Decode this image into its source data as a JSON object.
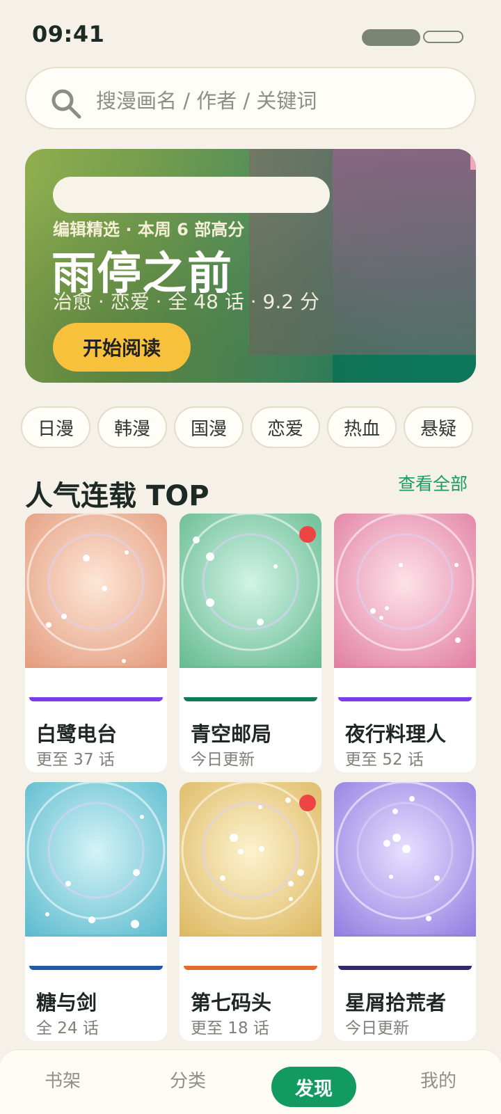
{
  "status": {
    "time": "09:41"
  },
  "search": {
    "placeholder": "搜漫画名 / 作者 / 关键词"
  },
  "hero": {
    "kicker": "编辑精选 · 本周 6 部高分",
    "title": "雨停之前",
    "meta": "治愈 · 恋爱 · 全 48 话 · 9.2 分",
    "button": "开始阅读"
  },
  "chips": [
    "日漫",
    "韩漫",
    "国漫",
    "恋爱",
    "热血",
    "悬疑"
  ],
  "section": {
    "title": "人气连载 TOP",
    "link": "查看全部"
  },
  "cards": [
    {
      "title": "白鹭电台",
      "sub": "更至 37 话",
      "band": "#7c3aed",
      "new": false,
      "c1": "#fde6d6",
      "c2": "#e39a7c"
    },
    {
      "title": "青空邮局",
      "sub": "今日更新",
      "band": "#0f7a5a",
      "new": true,
      "c1": "#d2f3e6",
      "c2": "#63b98f"
    },
    {
      "title": "夜行料理人",
      "sub": "更至 52 话",
      "band": "#7c3aed",
      "new": false,
      "c1": "#fde2ea",
      "c2": "#e17da0"
    },
    {
      "title": "糖与剑",
      "sub": "全 24 话",
      "band": "#1e5aa8",
      "new": false,
      "c1": "#d4f3f7",
      "c2": "#58b9cc"
    },
    {
      "title": "第七码头",
      "sub": "更至 18 话",
      "band": "#e46a2c",
      "new": true,
      "c1": "#fdf2cf",
      "c2": "#dcb75e"
    },
    {
      "title": "星屑拾荒者",
      "sub": "今日更新",
      "band": "#2e2a6b",
      "new": false,
      "c1": "#e7e0ff",
      "c2": "#8e7ce0"
    }
  ],
  "tabs": {
    "shelf": "书架",
    "category": "分类",
    "discover": "发现",
    "mine": "我的"
  }
}
